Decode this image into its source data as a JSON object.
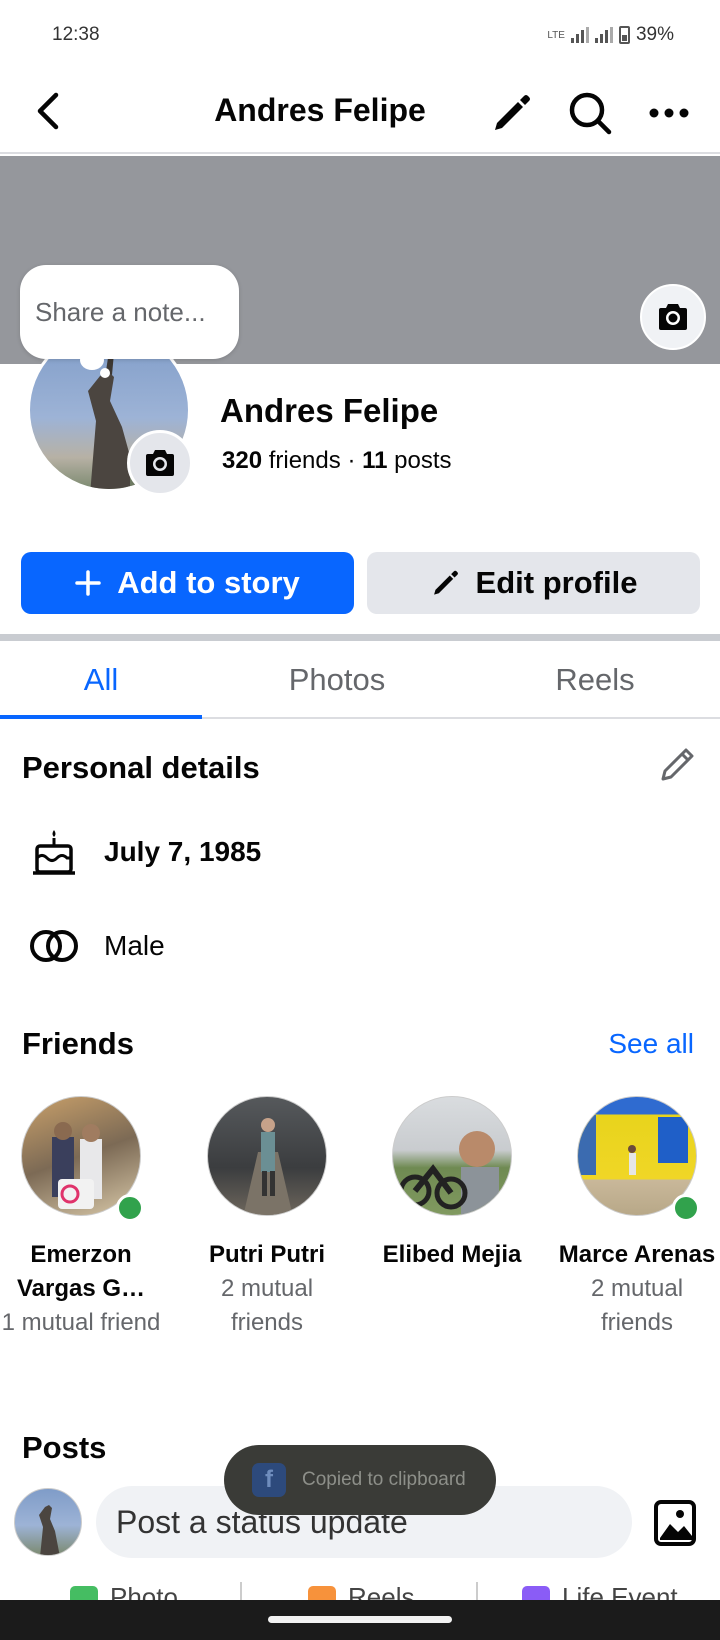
{
  "status": {
    "time": "12:38",
    "network": "LTE",
    "battery": "39%"
  },
  "header": {
    "title": "Andres Felipe"
  },
  "note": {
    "placeholder": "Share a note..."
  },
  "profile": {
    "name": "Andres Felipe",
    "friends_count": "320",
    "friends_label": "friends",
    "separator": "·",
    "posts_count": "11",
    "posts_label": "posts"
  },
  "buttons": {
    "add_story": "Add to story",
    "edit_profile": "Edit profile"
  },
  "tabs": [
    {
      "label": "All"
    },
    {
      "label": "Photos"
    },
    {
      "label": "Reels"
    }
  ],
  "details": {
    "title": "Personal details",
    "birthday": "July 7, 1985",
    "gender": "Male"
  },
  "friends": {
    "title": "Friends",
    "see_all": "See all",
    "items": [
      {
        "name": "Emerzon Vargas G…",
        "mutual": "1 mutual friend",
        "online": true
      },
      {
        "name": "Putri Putri",
        "mutual": "2 mutual friends",
        "online": false
      },
      {
        "name": "Elibed Mejia",
        "mutual": "",
        "online": false
      },
      {
        "name": "Marce Arenas",
        "mutual": "2 mutual friends",
        "online": true
      }
    ]
  },
  "posts": {
    "title": "Posts",
    "composer_placeholder": "Post a status update",
    "actions": [
      {
        "label": "Photo"
      },
      {
        "label": "Reels"
      },
      {
        "label": "Life Event"
      }
    ]
  },
  "toast": {
    "text": "Copied to clipboard"
  },
  "colors": {
    "accent": "#0866ff",
    "online": "#31a24c",
    "cover": "#95979c"
  }
}
